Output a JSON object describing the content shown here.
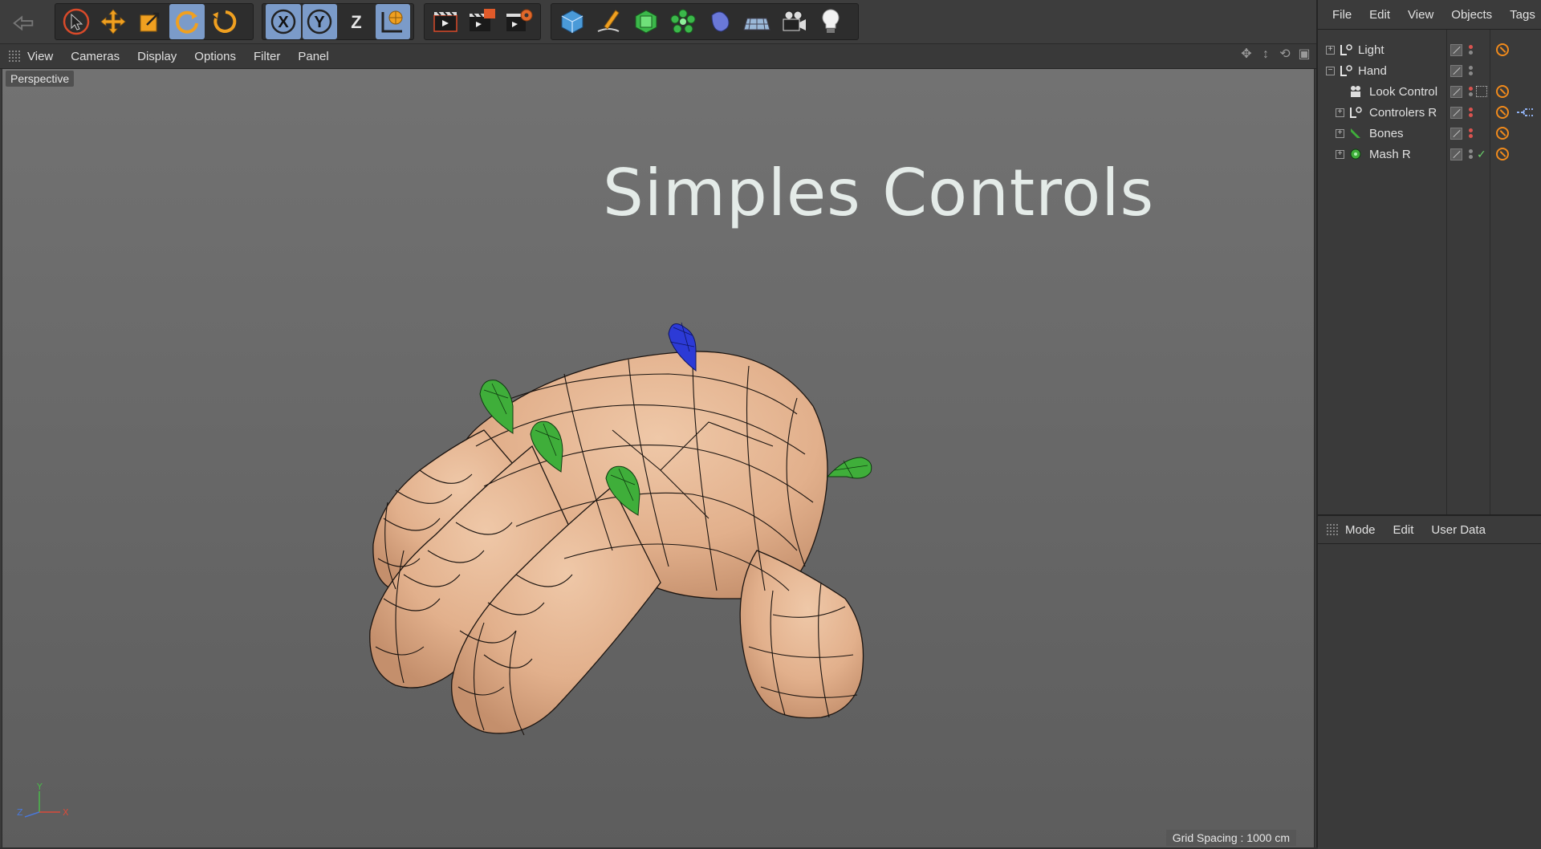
{
  "toolbar": {
    "undo": "undo-icon",
    "groups": [
      {
        "name": "transform-tools",
        "items": [
          {
            "icon": "select-arrow-icon",
            "active": false
          },
          {
            "icon": "move-icon",
            "active": false
          },
          {
            "icon": "scale-icon",
            "active": false
          },
          {
            "icon": "rotate-icon",
            "active": true
          },
          {
            "icon": "rotate-alt-icon",
            "active": false
          }
        ]
      },
      {
        "name": "axis-lock",
        "items": [
          {
            "icon": "x-axis-icon",
            "label": "X",
            "active": true
          },
          {
            "icon": "y-axis-icon",
            "label": "Y",
            "active": true
          },
          {
            "icon": "z-axis-icon",
            "label": "Z",
            "active": false
          },
          {
            "icon": "world-coordinates-icon",
            "active": true
          }
        ]
      },
      {
        "name": "render",
        "items": [
          {
            "icon": "render-view-icon"
          },
          {
            "icon": "render-picture-viewer-icon"
          },
          {
            "icon": "render-settings-icon"
          }
        ]
      },
      {
        "name": "create",
        "items": [
          {
            "icon": "cube-icon"
          },
          {
            "icon": "pen-spline-icon"
          },
          {
            "icon": "subdivision-icon"
          },
          {
            "icon": "array-cloner-icon"
          },
          {
            "icon": "deformer-icon"
          },
          {
            "icon": "floor-scene-icon"
          },
          {
            "icon": "camera-icon"
          },
          {
            "icon": "light-bulb-icon"
          }
        ]
      }
    ]
  },
  "viewport_menu": [
    "View",
    "Cameras",
    "Display",
    "Options",
    "Filter",
    "Panel"
  ],
  "viewport": {
    "label": "Perspective",
    "title": "Simples Controls",
    "grid_spacing": "Grid Spacing : 1000 cm",
    "axis": {
      "x": "X",
      "y": "Y",
      "z": "Z"
    }
  },
  "object_manager": {
    "menu": [
      "File",
      "Edit",
      "View",
      "Objects",
      "Tags"
    ],
    "objects": [
      {
        "name": "Light",
        "icon": "null-object-icon",
        "level": 0,
        "expander": "plus",
        "vis_dots": [
          "#d9534f",
          "#8a8a8a"
        ],
        "tags": [
          "forbidden-tag-icon"
        ]
      },
      {
        "name": "Hand",
        "icon": "null-object-icon",
        "level": 0,
        "expander": "minus",
        "vis_dots": [
          "#8a8a8a",
          "#8a8a8a"
        ],
        "tags": []
      },
      {
        "name": "Look Control",
        "icon": "camera-target-icon",
        "level": 1,
        "expander": "none",
        "vis_dots": [
          "#d9534f",
          "#8a8a8a"
        ],
        "tags": [
          "forbidden-tag-icon"
        ]
      },
      {
        "name": "Controlers R",
        "icon": "null-object-icon",
        "level": 1,
        "expander": "plus",
        "vis_dots": [
          "#d9534f",
          "#d9534f"
        ],
        "tags": [
          "forbidden-tag-icon",
          "xpresso-tag-icon"
        ]
      },
      {
        "name": "Bones",
        "icon": "bone-icon",
        "level": 1,
        "expander": "plus",
        "vis_dots": [
          "#d9534f",
          "#d9534f"
        ],
        "tags": [
          "forbidden-tag-icon"
        ]
      },
      {
        "name": "Mash R",
        "icon": "mesh-object-icon",
        "level": 1,
        "expander": "plus",
        "vis_dots": [
          "#8a8a8a",
          "#8a8a8a"
        ],
        "check": true,
        "tags": [
          "forbidden-tag-icon"
        ]
      }
    ]
  },
  "attribute_manager": {
    "menu": [
      "Mode",
      "Edit",
      "User Data"
    ]
  },
  "colors": {
    "accent": "#7b9bc9",
    "viewport_bg": "#6b6b6b",
    "hand_skin": "#e6b898",
    "controller_green": "#3fae3a",
    "controller_blue": "#2c3ad6",
    "tag_orange": "#f08a1c"
  }
}
